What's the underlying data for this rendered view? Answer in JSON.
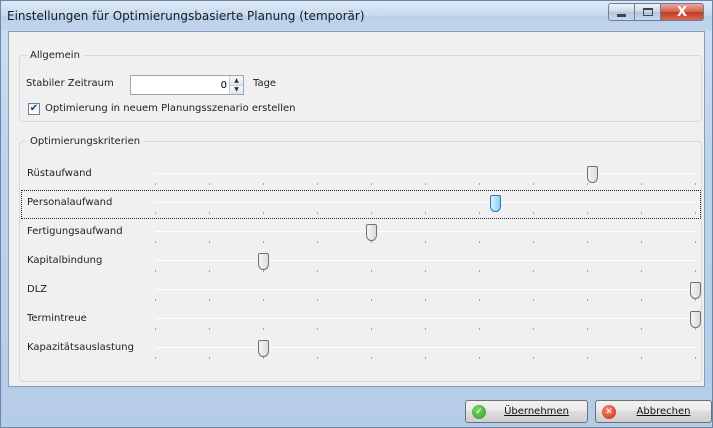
{
  "window": {
    "title": "Einstellungen für Optimierungsbasierte Planung (temporär)",
    "close_label": "X"
  },
  "general": {
    "legend": "Allgemein",
    "stable_period_label": "Stabiler Zeitraum",
    "stable_period_value": "0",
    "stable_period_unit": "Tage",
    "new_scenario_label": "Optimierung in neuem Planungsszenario erstellen",
    "new_scenario_checked": true
  },
  "criteria": {
    "legend": "Optimierungskriterien",
    "slider_min": 0,
    "slider_max": 10,
    "items": [
      {
        "label": "Rüstaufwand",
        "value": 8.1
      },
      {
        "label": "Personalaufwand",
        "value": 6.3
      },
      {
        "label": "Fertigungsaufwand",
        "value": 4.0
      },
      {
        "label": "Kapitalbindung",
        "value": 2.0
      },
      {
        "label": "DLZ",
        "value": 10
      },
      {
        "label": "Termintreue",
        "value": 10
      },
      {
        "label": "Kapazitätsauslastung",
        "value": 2.0
      }
    ],
    "focused_index": 1
  },
  "buttons": {
    "ok_label": "Übernehmen",
    "cancel_label": "Abbrechen"
  }
}
